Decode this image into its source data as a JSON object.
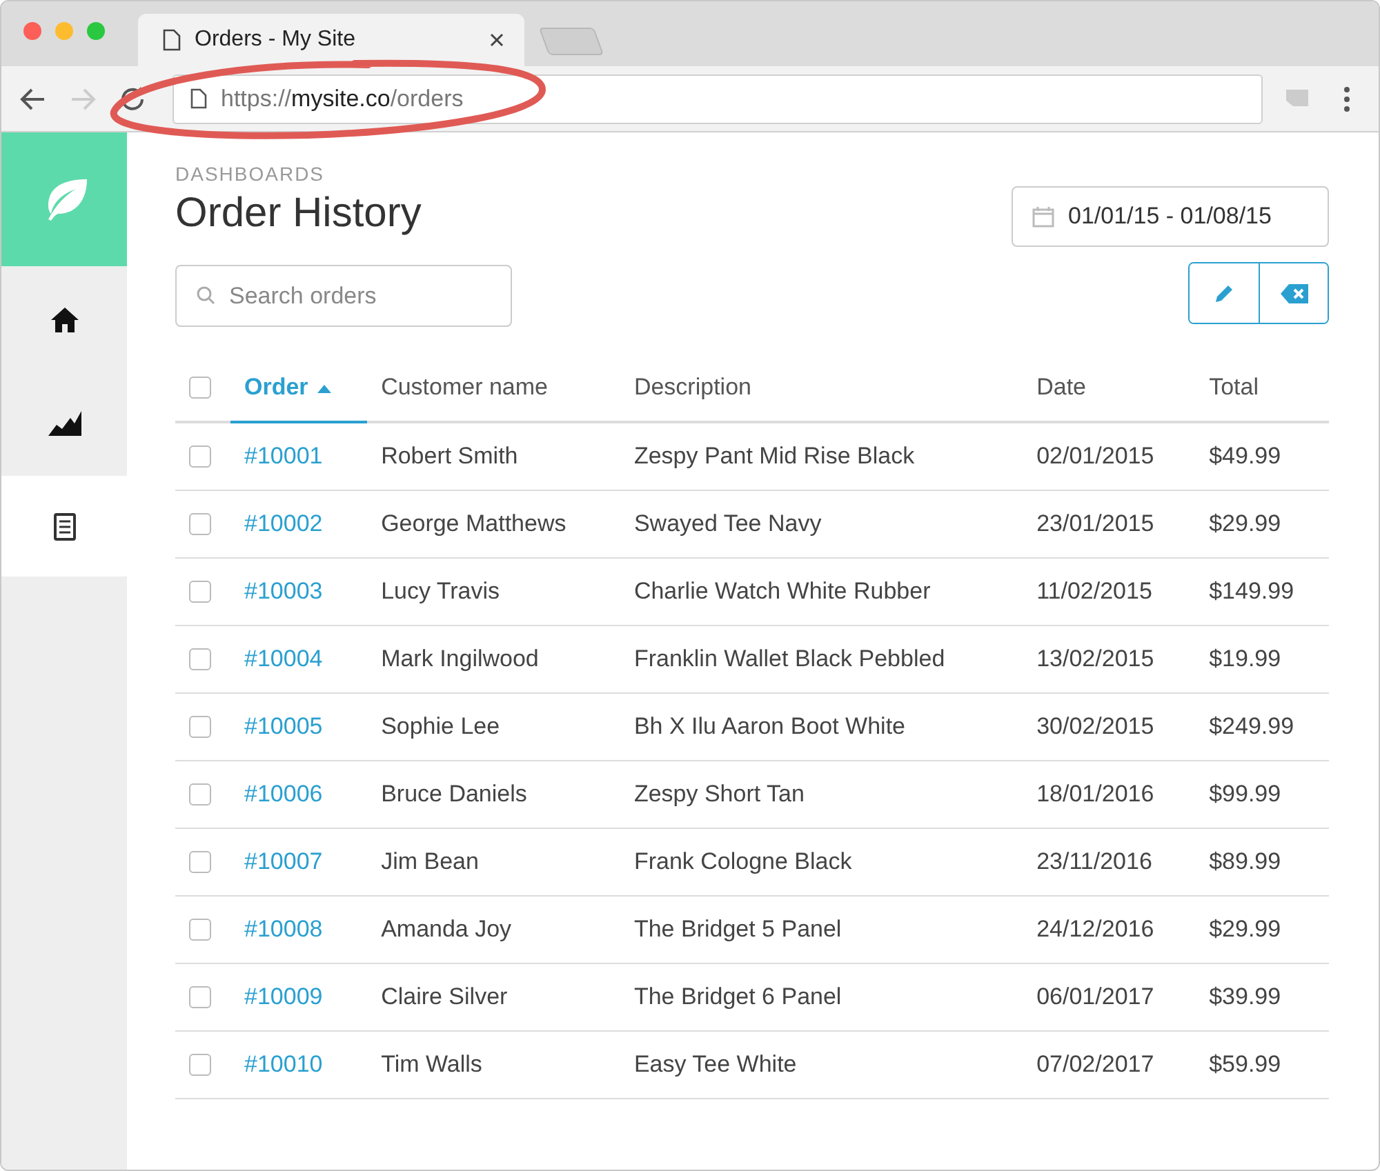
{
  "browser": {
    "tab_title": "Orders - My Site",
    "url": "https://**mysite.co**/orders"
  },
  "sidebar": {
    "items": [
      {
        "kind": "home",
        "selected": false
      },
      {
        "kind": "chart",
        "selected": false
      },
      {
        "kind": "document",
        "selected": true
      }
    ]
  },
  "page": {
    "breadcrumb": "DASHBOARDS",
    "title": "Order History",
    "date_range": "01/01/15 - 01/08/15",
    "search": {
      "placeholder": "Search orders"
    }
  },
  "table": {
    "all_checked": false,
    "columns": [
      {
        "label": "Order",
        "sorted": true
      },
      {
        "label": "Customer name",
        "sorted": false
      },
      {
        "label": "Description",
        "sorted": false
      },
      {
        "label": "Date",
        "sorted": false
      },
      {
        "label": "Total",
        "sorted": false
      }
    ],
    "rows": [
      {
        "checked": false,
        "order": "#10001",
        "customer": "Robert Smith",
        "description": "Zespy Pant Mid Rise Black",
        "date": "02/01/2015",
        "total": "$49.99"
      },
      {
        "checked": false,
        "order": "#10002",
        "customer": "George Matthews",
        "description": "Swayed Tee Navy",
        "date": "23/01/2015",
        "total": "$29.99"
      },
      {
        "checked": false,
        "order": "#10003",
        "customer": "Lucy Travis",
        "description": "Charlie Watch White Rubber",
        "date": "11/02/2015",
        "total": "$149.99"
      },
      {
        "checked": false,
        "order": "#10004",
        "customer": "Mark Ingilwood",
        "description": "Franklin Wallet Black Pebbled",
        "date": "13/02/2015",
        "total": "$19.99"
      },
      {
        "checked": false,
        "order": "#10005",
        "customer": "Sophie Lee",
        "description": "Bh X Ilu Aaron Boot White",
        "date": "30/02/2015",
        "total": "$249.99"
      },
      {
        "checked": false,
        "order": "#10006",
        "customer": "Bruce Daniels",
        "description": "Zespy Short Tan",
        "date": "18/01/2016",
        "total": "$99.99"
      },
      {
        "checked": false,
        "order": "#10007",
        "customer": "Jim Bean",
        "description": "Frank Cologne Black",
        "date": "23/11/2016",
        "total": "$89.99"
      },
      {
        "checked": false,
        "order": "#10008",
        "customer": "Amanda Joy",
        "description": "The Bridget 5 Panel",
        "date": "24/12/2016",
        "total": "$29.99"
      },
      {
        "checked": false,
        "order": "#10009",
        "customer": "Claire Silver",
        "description": "The Bridget 6 Panel",
        "date": "06/01/2017",
        "total": "$39.99"
      },
      {
        "checked": false,
        "order": "#10010",
        "customer": "Tim Walls",
        "description": "Easy Tee White",
        "date": "07/02/2017",
        "total": "$59.99"
      }
    ]
  }
}
